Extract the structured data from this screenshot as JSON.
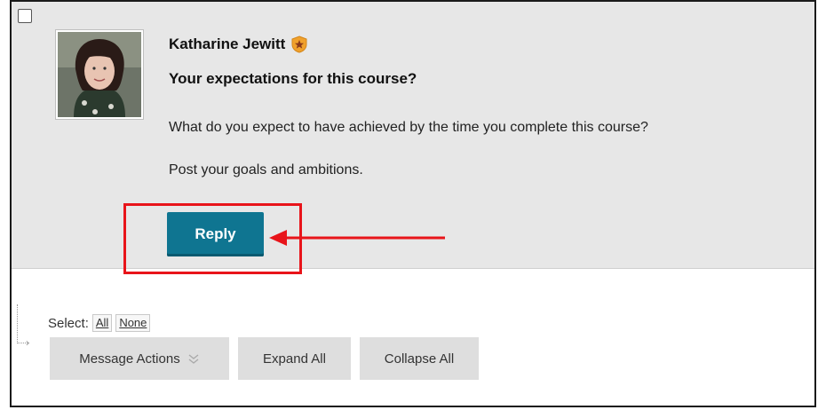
{
  "post": {
    "author": "Katharine Jewitt",
    "author_badge_icon": "star-badge-icon",
    "title": "Your expectations for this course?",
    "body_line1": "What do you expect to have achieved by the time you complete this course?",
    "body_line2": "Post your goals and ambitions.",
    "reply_label": "Reply"
  },
  "toolbar": {
    "select_label": "Select:",
    "select_all": "All",
    "select_none": "None",
    "message_actions": "Message Actions",
    "expand_all": "Expand All",
    "collapse_all": "Collapse All"
  },
  "colors": {
    "post_background": "#e7e7e7",
    "reply_button": "#0f7591",
    "annotation_red": "#e8141a",
    "action_button": "#dedede"
  }
}
